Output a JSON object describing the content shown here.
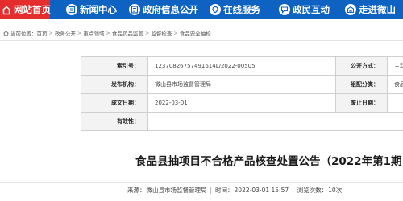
{
  "nav": {
    "items": [
      {
        "label": "网站首页",
        "icon": "home-icon"
      },
      {
        "label": "新闻中心",
        "icon": "news-icon"
      },
      {
        "label": "政府信息公开",
        "icon": "info-icon"
      },
      {
        "label": "在线服务",
        "icon": "service-icon"
      },
      {
        "label": "政民互动",
        "icon": "interaction-icon"
      },
      {
        "label": "走进微山",
        "icon": "city-icon"
      }
    ],
    "active_color": "#e52d2d",
    "bar_color": "#0d62c2"
  },
  "breadcrumb": {
    "prefix": "当前位置：",
    "items": [
      "首页",
      "政务公开",
      "重点领域",
      "食品药品监管",
      "监督检查",
      "食品安全抽检"
    ],
    "separator": ">"
  },
  "meta": {
    "index_label": "索引号：",
    "index_value": "12370826757491614L/2022-00505",
    "disclosure_label": "公开方式：",
    "disclosure_value": "主动",
    "publisher_label": "发布机构：",
    "publisher_value": "微山县市场监督管理局",
    "category_label": "组配分类：",
    "category_value": "食品",
    "date_label": "成文日期：",
    "date_value": "2022-03-01",
    "repeal_label": "废止日期：",
    "repeal_value": "",
    "validity_label": "有效性：",
    "validity_value": ""
  },
  "article": {
    "title": "食品县抽项目不合格产品核查处置公告（2022年第1期",
    "source_label": "来源：",
    "source_value": "微山县市场监督管理局",
    "time_label": "时间：",
    "time_value": "2022-03-01 15:57",
    "views_label": "浏览次数：",
    "views_value": "10次"
  }
}
